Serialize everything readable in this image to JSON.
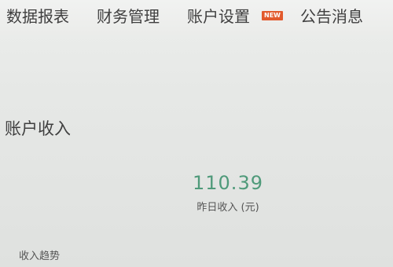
{
  "nav": {
    "items": [
      {
        "label": "数据报表"
      },
      {
        "label": "财务管理"
      },
      {
        "label": "账户设置",
        "badge": "NEW"
      },
      {
        "label": "公告消息"
      }
    ]
  },
  "account_income": {
    "title": "账户收入",
    "yesterday_value": "110.39",
    "yesterday_label": "昨日收入 (元)",
    "trend_label": "收入趋势"
  },
  "colors": {
    "value_green": "#4f9a7a",
    "badge_orange": "#e25a2c"
  }
}
